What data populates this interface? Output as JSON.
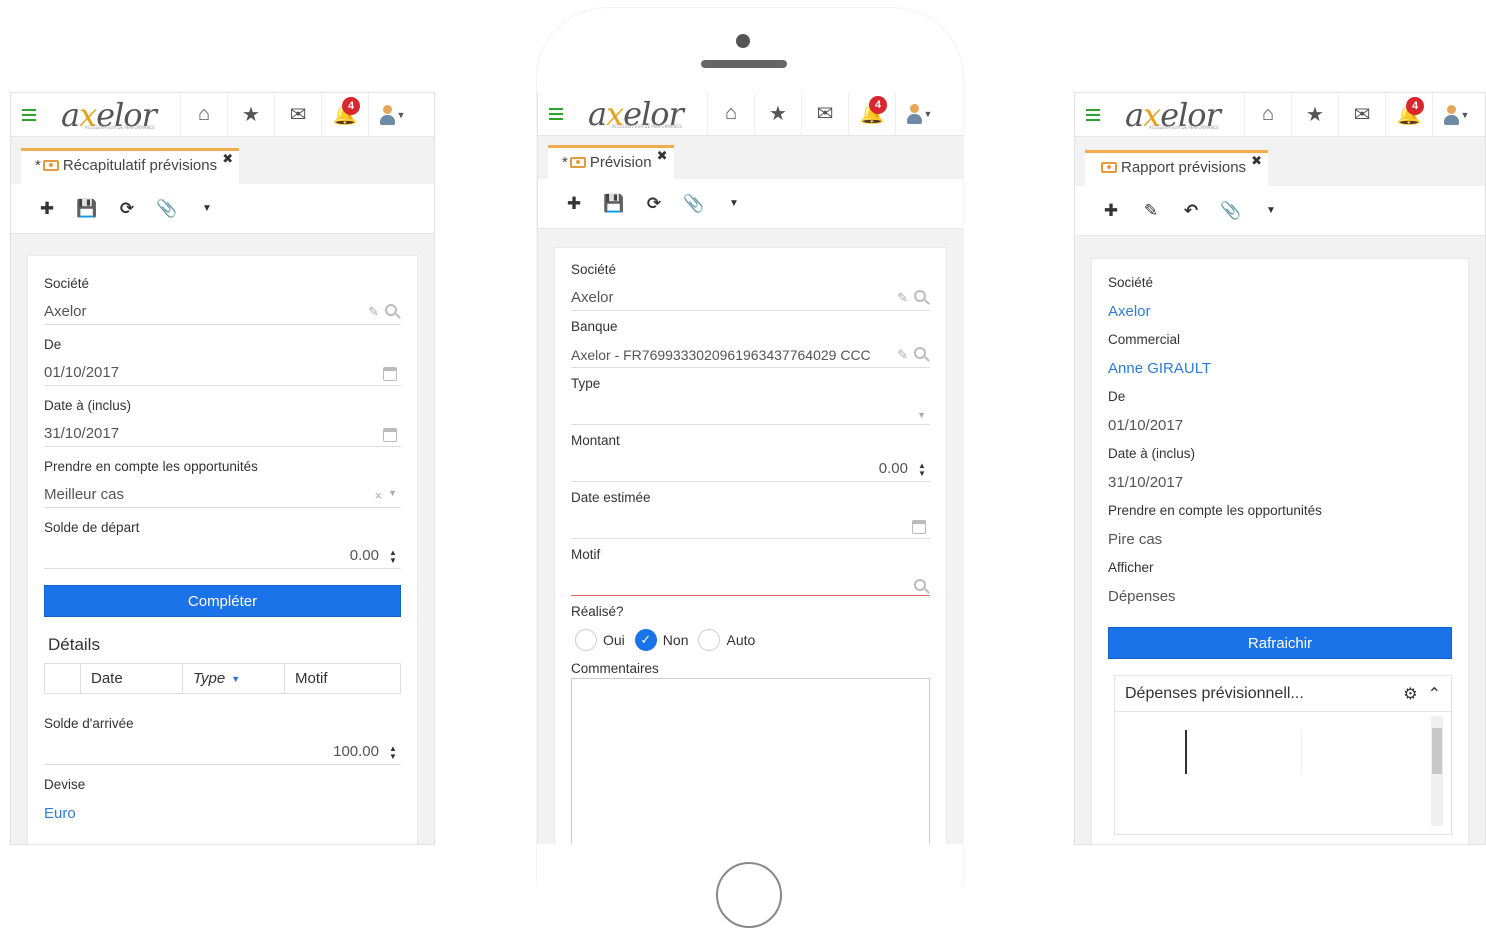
{
  "common": {
    "logo": "axelor",
    "logo_tagline": "ACCELERATEUR DE PERFORMANCE",
    "notif_count": "4",
    "icons": [
      "menu-icon",
      "home-icon",
      "star-icon",
      "mail-icon",
      "bell-icon",
      "user-icon"
    ]
  },
  "left": {
    "tab": "Récapitulatif prévisions",
    "tab_dirty": "*",
    "fields": {
      "societe_label": "Société",
      "societe_value": "Axelor",
      "de_label": "De",
      "de_value": "01/10/2017",
      "date_label": "Date à (inclus)",
      "date_value": "31/10/2017",
      "opp_label": "Prendre en compte les opportunités",
      "opp_value": "Meilleur cas",
      "solde_label": "Solde de départ",
      "solde_value": "0.00"
    },
    "button": "Compléter",
    "details_title": "Détails",
    "columns": [
      "Date",
      "Type",
      "Motif"
    ],
    "arrivee_label": "Solde d'arrivée",
    "arrivee_value": "100.00",
    "devise_label": "Devise",
    "devise_value": "Euro"
  },
  "middle": {
    "tab": "Prévision",
    "tab_dirty": "*",
    "fields": {
      "societe_label": "Société",
      "societe_value": "Axelor",
      "banque_label": "Banque",
      "banque_value": "Axelor - FR7699333020961963437764029 CCC",
      "type_label": "Type",
      "type_value": "",
      "montant_label": "Montant",
      "montant_value": "0.00",
      "date_label": "Date estimée",
      "date_value": "",
      "motif_label": "Motif",
      "motif_value": "",
      "realise_label": "Réalisé?",
      "commentaires_label": "Commentaires"
    },
    "radio_options": [
      "Oui",
      "Non",
      "Auto"
    ],
    "radio_selected": "Non"
  },
  "right": {
    "tab": "Rapport prévisions",
    "fields": {
      "societe_label": "Société",
      "societe_value": "Axelor",
      "commercial_label": "Commercial",
      "commercial_value": "Anne GIRAULT",
      "de_label": "De",
      "de_value": "01/10/2017",
      "date_label": "Date à (inclus)",
      "date_value": "31/10/2017",
      "opp_label": "Prendre en compte les opportunités",
      "opp_value": "Pire cas",
      "afficher_label": "Afficher",
      "afficher_value": "Dépenses"
    },
    "button": "Rafraichir",
    "chart_title": "Dépenses prévisionnell..."
  }
}
